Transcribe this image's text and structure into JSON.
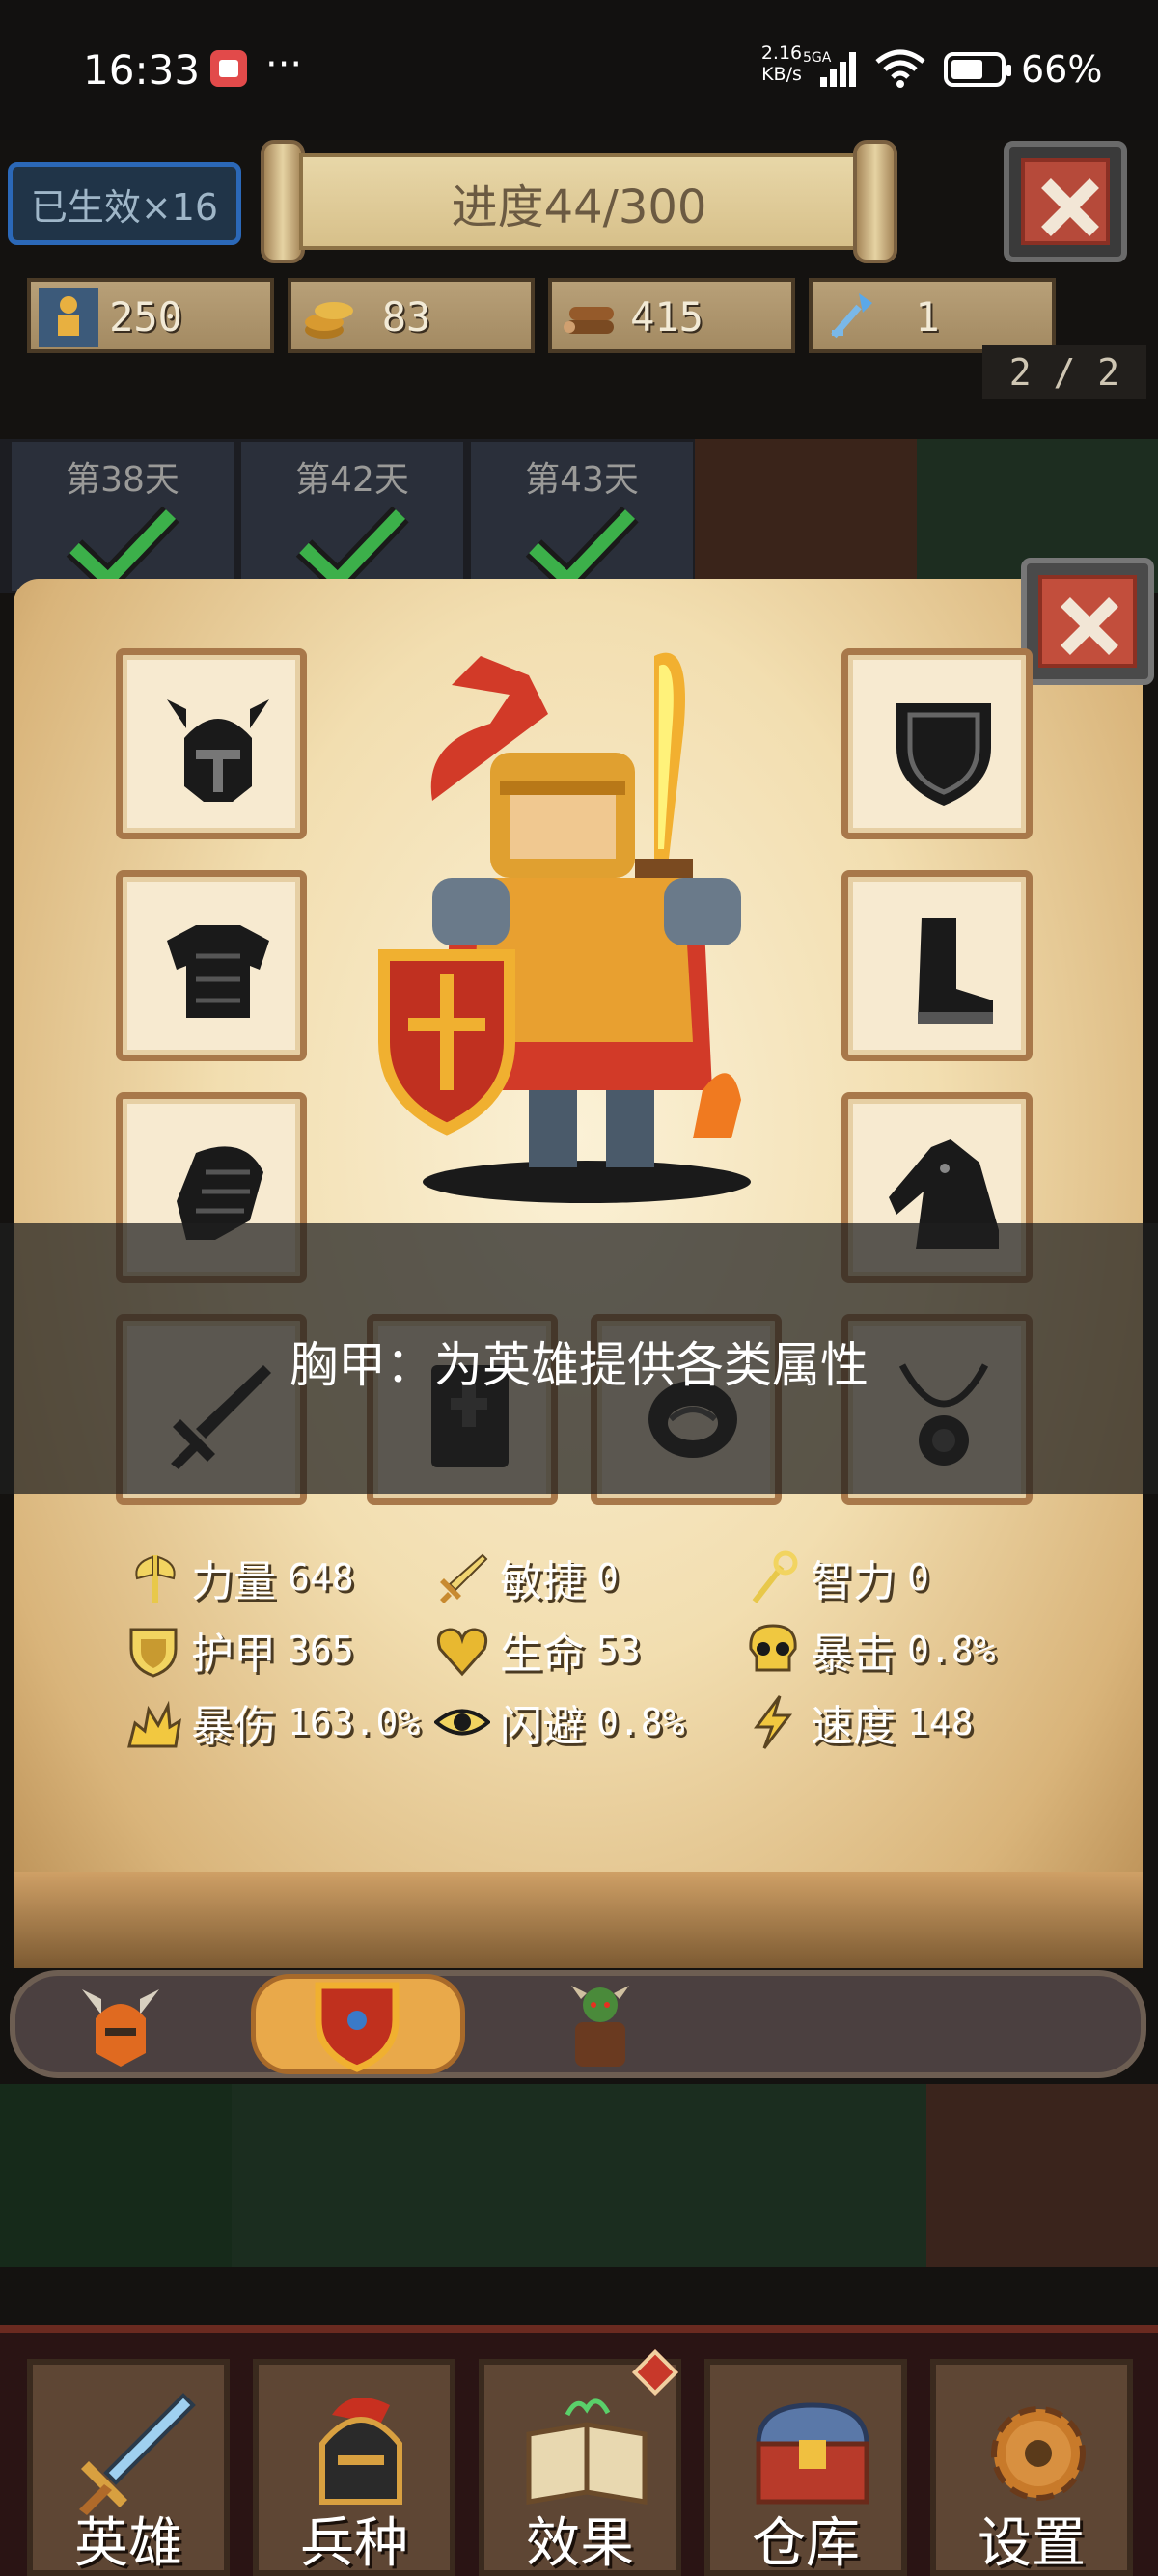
{
  "status_bar": {
    "time": "16:33",
    "more": "···",
    "net_speed": "2.16",
    "net_unit": "KB/s",
    "net_type": "5GA",
    "battery": "66%",
    "battery_level": 0.66
  },
  "hud": {
    "effects_badge": "已生效×16",
    "progress_title": "进度44/300",
    "resources": [
      {
        "icon": "recruit-icon",
        "value": "250"
      },
      {
        "icon": "gold-coins-icon",
        "value": "83"
      },
      {
        "icon": "wood-logs-icon",
        "value": "415"
      },
      {
        "icon": "blue-key-icon",
        "value": "1"
      }
    ],
    "page_indicator": "2 / 2"
  },
  "days": [
    {
      "label": "第38天",
      "completed": true
    },
    {
      "label": "第42天",
      "completed": true
    },
    {
      "label": "第43天",
      "completed": true
    }
  ],
  "hero_panel": {
    "slots_left": [
      "helmet-icon",
      "chest-armor-icon",
      "gauntlet-icon"
    ],
    "slots_right": [
      "shield-icon",
      "boot-icon",
      "horse-mount-icon"
    ],
    "slots_bottom": [
      "sword-icon",
      "book-icon",
      "ring-icon",
      "amulet-icon"
    ],
    "tooltip": "胸甲：为英雄提供各类属性",
    "stats": [
      {
        "icon": "axe-icon",
        "name": "力量",
        "value": "648"
      },
      {
        "icon": "dagger-icon",
        "name": "敏捷",
        "value": "0"
      },
      {
        "icon": "staff-icon",
        "name": "智力",
        "value": "0"
      },
      {
        "icon": "armor-shield-icon",
        "name": "护甲",
        "value": "365"
      },
      {
        "icon": "heart-icon",
        "name": "生命",
        "value": "53"
      },
      {
        "icon": "skull-icon",
        "name": "暴击",
        "value": "0.8%"
      },
      {
        "icon": "explosion-icon",
        "name": "暴伤",
        "value": "163.0%"
      },
      {
        "icon": "eye-icon",
        "name": "闪避",
        "value": "0.8%"
      },
      {
        "icon": "lightning-icon",
        "name": "速度",
        "value": "148"
      }
    ],
    "tabs": [
      "hero-helmet-tab",
      "shield-tab",
      "orc-warrior-tab"
    ],
    "active_tab": 1
  },
  "nav": [
    {
      "label": "英雄",
      "icon": "sword-icon"
    },
    {
      "label": "兵种",
      "icon": "knight-helmet-icon"
    },
    {
      "label": "效果",
      "icon": "spellbook-icon",
      "badge": true
    },
    {
      "label": "仓库",
      "icon": "treasure-chest-icon"
    },
    {
      "label": "设置",
      "icon": "gear-icon"
    }
  ],
  "colors": {
    "accent_green": "#3cb04a",
    "close_red": "#b64a3a",
    "parchment": "#f2deb0",
    "active_tab": "#e9a94a"
  }
}
